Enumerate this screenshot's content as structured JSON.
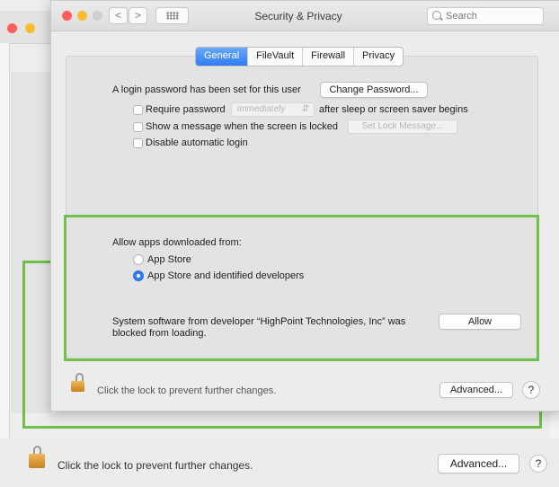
{
  "window": {
    "title": "Security & Privacy",
    "search_placeholder": "Search",
    "nav_back": "<",
    "nav_forward": ">",
    "grid_icon": "grid-icon"
  },
  "tabs": [
    {
      "label": "General",
      "active": true
    },
    {
      "label": "FileVault",
      "active": false
    },
    {
      "label": "Firewall",
      "active": false
    },
    {
      "label": "Privacy",
      "active": false
    }
  ],
  "general": {
    "login_password_text": "A login password has been set for this user",
    "change_password_button": "Change Password...",
    "require_password_label": "Require password",
    "require_password_value": "immediately",
    "require_password_suffix": "after sleep or screen saver begins",
    "show_message_label": "Show a message when the screen is locked",
    "set_lock_message_button": "Set Lock Message...",
    "disable_auto_login_label": "Disable automatic login"
  },
  "allow_apps": {
    "heading": "Allow apps downloaded from:",
    "options": [
      {
        "label": "App Store",
        "selected": false
      },
      {
        "label": "App Store and identified developers",
        "selected": true
      }
    ],
    "blocked_message_line1": "System software from developer “HighPoint Technologies, Inc” was",
    "blocked_message_line2": "blocked from loading.",
    "allow_button": "Allow"
  },
  "footer": {
    "lock_text": "Click the lock to prevent further changes.",
    "advanced_button": "Advanced...",
    "help_button": "?"
  },
  "colors": {
    "accent": "#2f7cf6",
    "highlight_frame": "#71c14b",
    "close": "#fc5f57",
    "minimize": "#fdbc2e",
    "zoom_disabled": "#cfcfcf"
  }
}
